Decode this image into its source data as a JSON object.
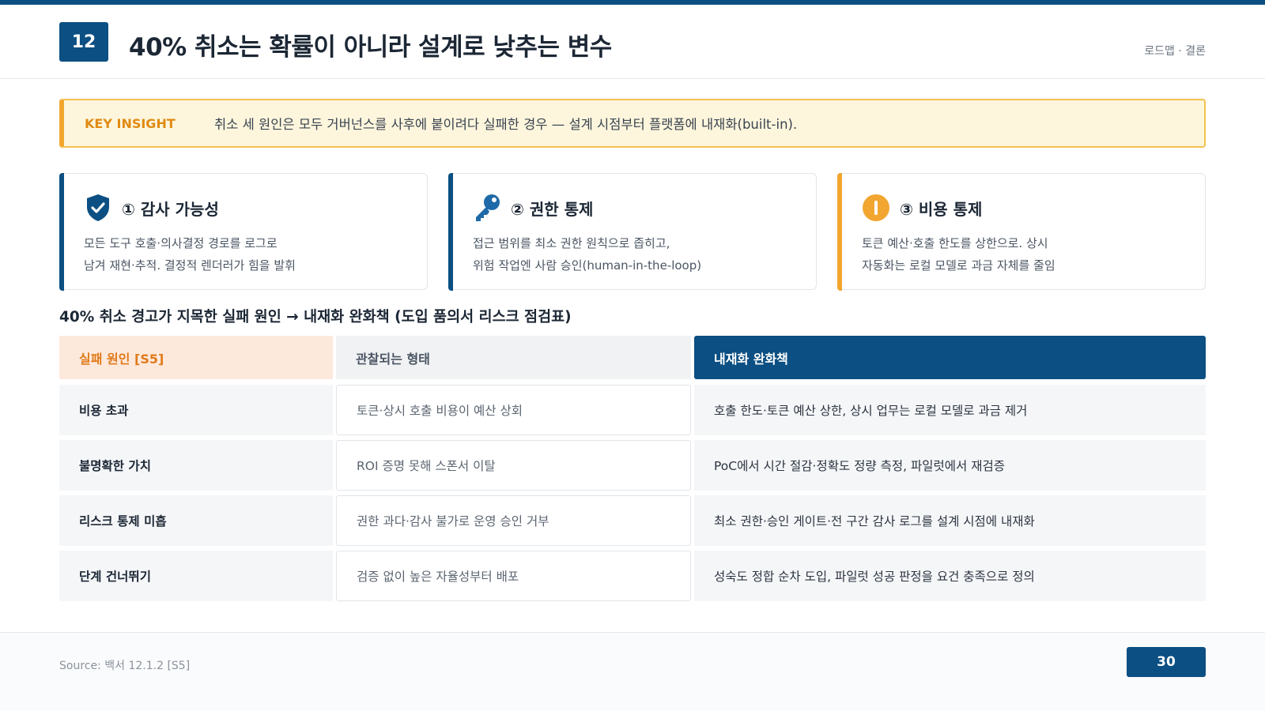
{
  "header": {
    "slide_number": "12",
    "title": "40% 취소는 확률이 아니라 설계로 낮추는 변수",
    "section": "로드맵 · 결론"
  },
  "insight": {
    "label": "KEY INSIGHT",
    "text": "취소 세 원인은 모두 거버넌스를 사후에 붙이려다 실패한 경우 — 설계 시점부터 플랫폼에 내재화(built-in)."
  },
  "cards": [
    {
      "icon": "shield-check-icon",
      "accent": "#0b4f83",
      "title": "① 감사 가능성",
      "lines": [
        "모든 도구 호출·의사결정 경로를 로그로",
        "남겨 재현·추적. 결정적 렌더러가 힘을 발휘"
      ]
    },
    {
      "icon": "key-icon",
      "accent": "#0b4f83",
      "title": "② 권한 통제",
      "lines": [
        "접근 범위를 최소 권한 원칙으로 좁히고,",
        "위험 작업엔 사람 승인(human-in-the-loop)"
      ]
    },
    {
      "icon": "alert-circle-icon",
      "accent": "#f2a62f",
      "title": "③ 비용 통제",
      "lines": [
        "토큰 예산·호출 한도를 상한으로. 상시",
        "자동화는 로컬 모델로 과금 자체를 줄임"
      ]
    }
  ],
  "table": {
    "heading": "40% 취소 경고가 지목한 실패 원인 → 내재화 완화책 (도입 품의서 리스크 점검표)",
    "columns": [
      "실패 원인 [S5]",
      "관찰되는 형태",
      "내재화 완화책"
    ],
    "rows": [
      [
        "비용 초과",
        "토큰·상시 호출 비용이 예산 상회",
        "호출 한도·토큰 예산 상한, 상시 업무는 로컬 모델로 과금 제거"
      ],
      [
        "불명확한 가치",
        "ROI 증명 못해 스폰서 이탈",
        "PoC에서 시간 절감·정확도 정량 측정, 파일럿에서 재검증"
      ],
      [
        "리스크 통제 미흡",
        "권한 과다·감사 불가로 운영 승인 거부",
        "최소 권한·승인 게이트·전 구간 감사 로그를 설계 시점에 내재화"
      ],
      [
        "단계 건너뛰기",
        "검증 없이 높은 자율성부터 배포",
        "성숙도 정합 순차 도입, 파일럿 성공 판정을 요건 충족으로 정의"
      ]
    ]
  },
  "footer": {
    "source": "Source: 백서 12.1.2 [S5]",
    "page": "30"
  },
  "colors": {
    "primary": "#0b4f83",
    "accent": "#f2a62f",
    "insight_bg": "#fdf6dd"
  }
}
